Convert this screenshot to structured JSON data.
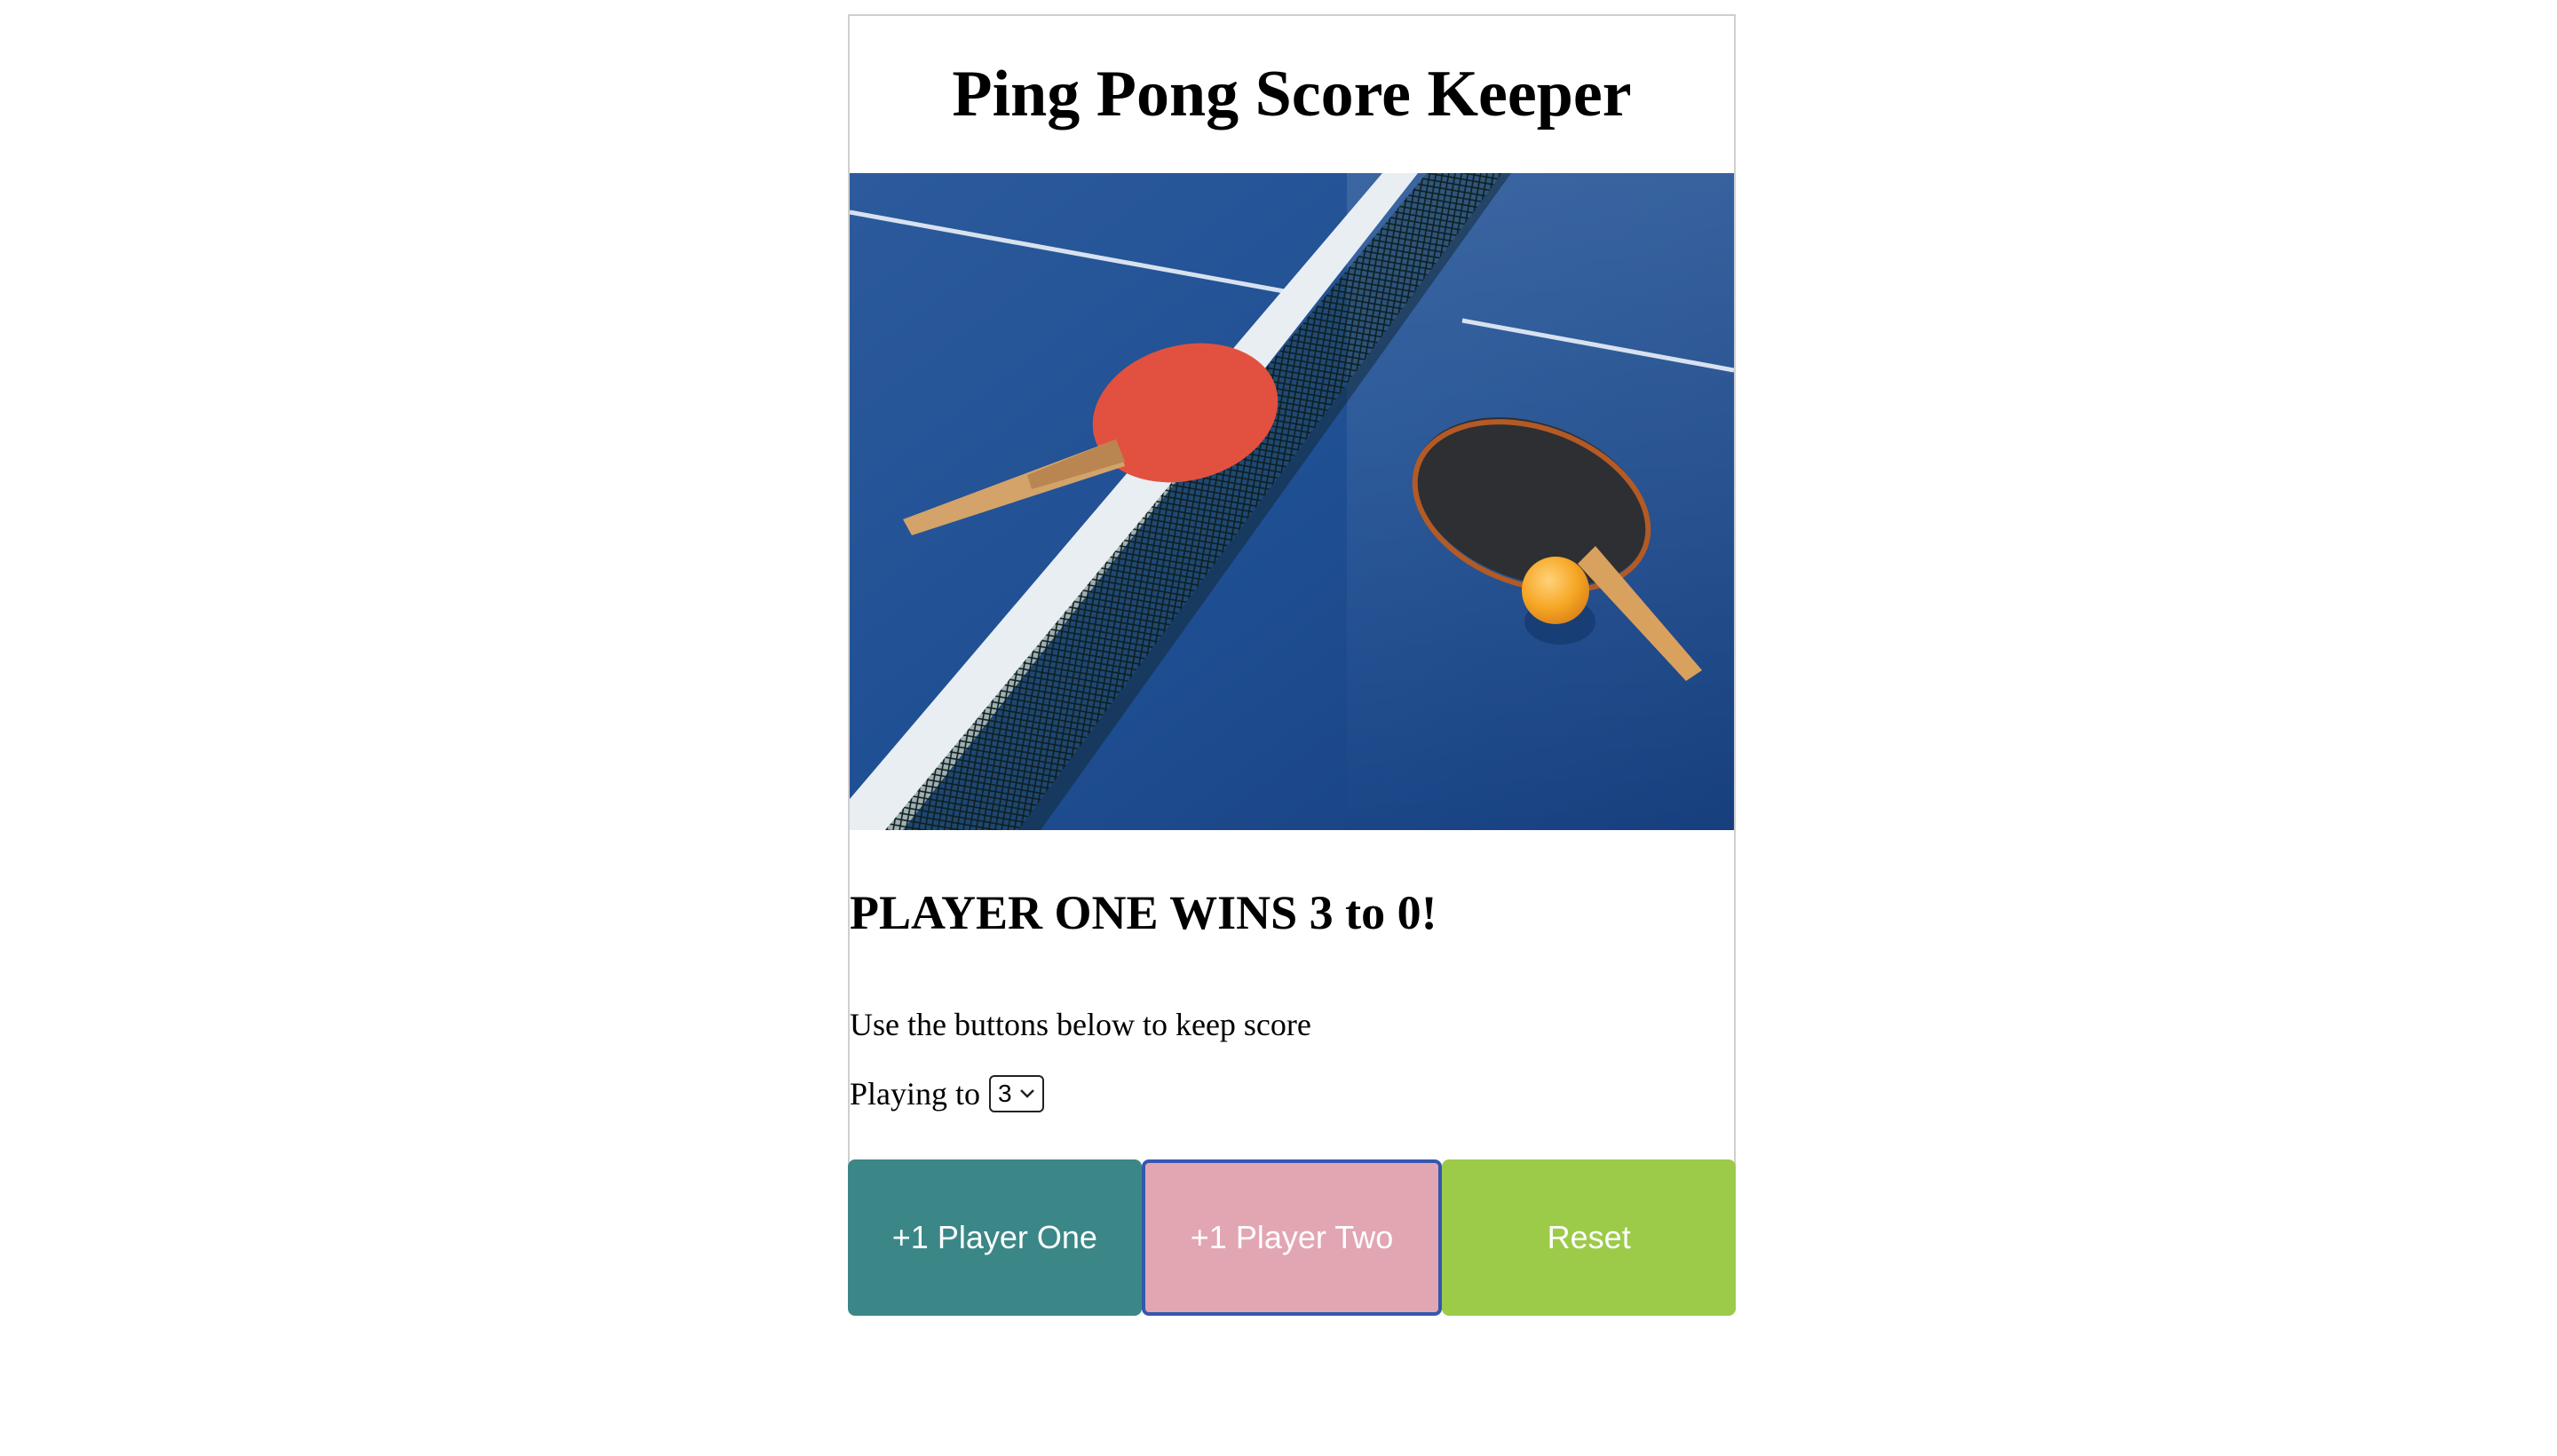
{
  "header": {
    "title": "Ping Pong Score Keeper"
  },
  "image": {
    "description_icon": "ping-pong-table-photo"
  },
  "result": {
    "message": "PLAYER ONE WINS 3 to 0!"
  },
  "instructions": {
    "text": "Use the buttons below to keep score"
  },
  "playing_to": {
    "label": "Playing to",
    "selected": "3"
  },
  "buttons": {
    "player_one": "+1 Player One",
    "player_two": "+1 Player Two",
    "reset": "Reset"
  },
  "colors": {
    "player_one": "#3b8787",
    "player_two": "#e2a6b3",
    "reset": "#9ccb4a",
    "focus_ring": "#3457b0"
  }
}
